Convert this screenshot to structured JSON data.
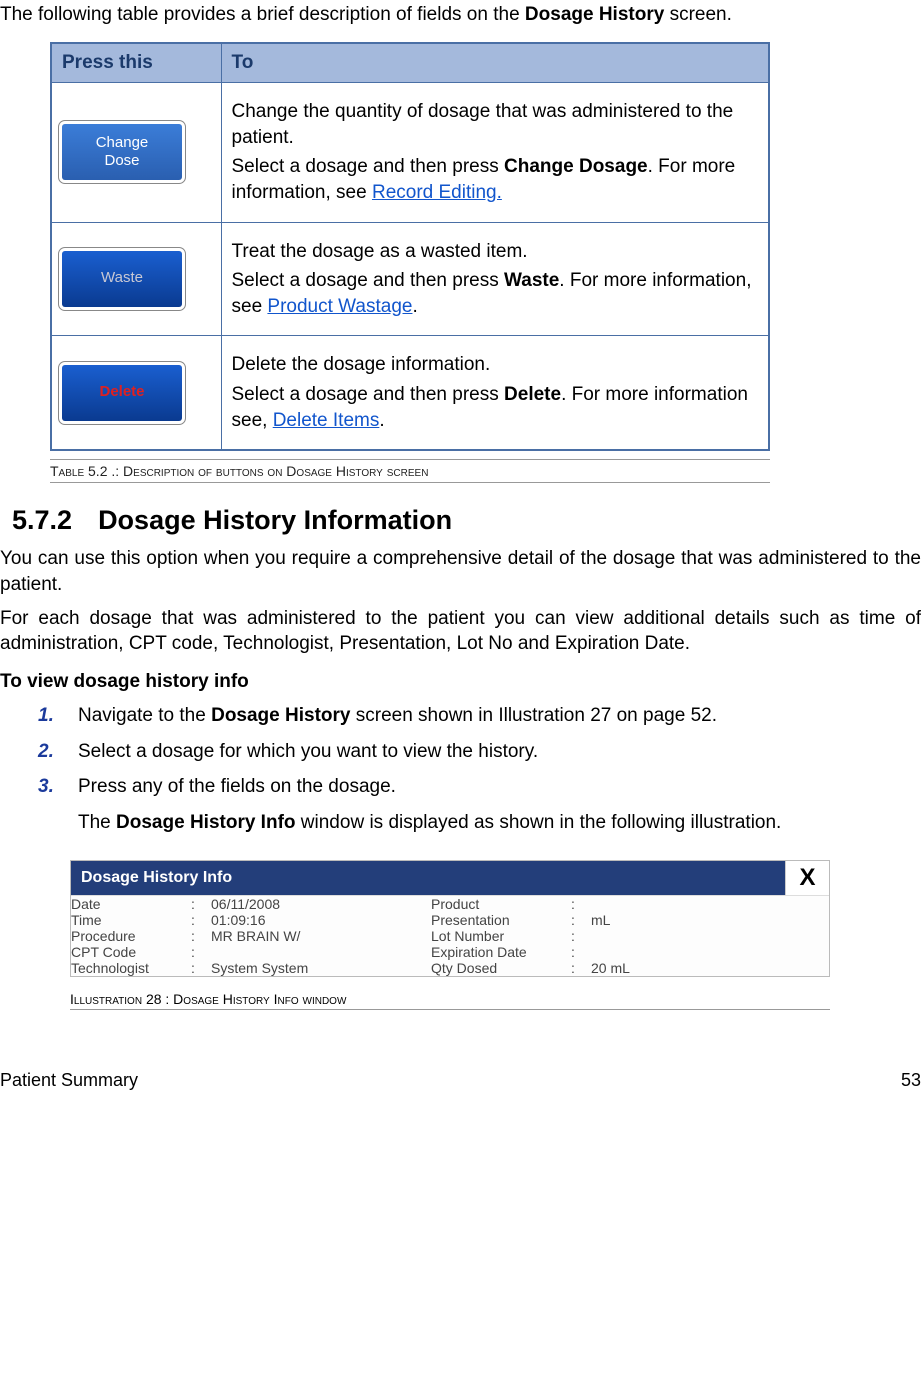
{
  "intro": {
    "pre": "The following table provides a brief description of fields on the ",
    "bold": "Dosage History",
    "post": " screen."
  },
  "table": {
    "headers": {
      "col1": "Press this",
      "col2": "To"
    },
    "rows": [
      {
        "button_label": "Change\nDose",
        "button_class": "btn-change",
        "desc1": "Change the quantity of dosage that was administered to the patient.",
        "desc2_pre": "Select a dosage and then press ",
        "desc2_bold": "Change Dosage",
        "desc2_mid": ". For more information, see ",
        "desc2_link": "Record Editing."
      },
      {
        "button_label": "Waste",
        "button_class": "btn-waste",
        "desc1": "Treat the dosage as a wasted item.",
        "desc2_pre": "Select a dosage and then press ",
        "desc2_bold": "Waste",
        "desc2_mid": ". For more information, see  ",
        "desc2_link": "Product Wastage",
        "desc2_post": "."
      },
      {
        "button_label": "Delete",
        "button_class": "btn-delete",
        "desc1": "Delete the dosage information.",
        "desc2_pre": "Select a dosage and then press ",
        "desc2_bold": "Delete",
        "desc2_mid": ".  For more information see, ",
        "desc2_link": " Delete Items",
        "desc2_post": "."
      }
    ]
  },
  "table_caption": "Table 5.2 .: Description of buttons on Dosage  History screen",
  "section": {
    "number": "5.7.2",
    "title": "Dosage History Information"
  },
  "para1": "You can use this option when you require a comprehensive detail of the dosage that was administered to the patient.",
  "para2": "For each dosage that was administered to the patient you can view additional details such as time of administration, CPT code, Technologist, Presentation, Lot No and Expiration Date.",
  "subhead": "To view dosage history info",
  "steps": [
    {
      "num": "1.",
      "pre": "Navigate to the ",
      "bold": "Dosage History",
      "post": " screen shown in Illustration 27 on page 52."
    },
    {
      "num": "2.",
      "pre": "Select a dosage for which you want to view the history.",
      "bold": "",
      "post": ""
    },
    {
      "num": "3.",
      "pre": "Press any of the fields on the dosage.",
      "bold": "",
      "post": "",
      "extra_pre": "The ",
      "extra_bold": "Dosage History Info",
      "extra_post": " window is displayed as shown in the following illustration."
    }
  ],
  "illus": {
    "title": "Dosage History Info",
    "close": "X",
    "rows": [
      {
        "l1": "Date",
        "v1": "06/11/2008",
        "l2": "Product",
        "v2": ""
      },
      {
        "l1": "Time",
        "v1": "01:09:16",
        "l2": "Presentation",
        "v2": "mL"
      },
      {
        "l1": "Procedure",
        "v1": "MR BRAIN W/",
        "l2": "Lot Number",
        "v2": ""
      },
      {
        "l1": "CPT Code",
        "v1": "",
        "l2": "Expiration Date",
        "v2": ""
      },
      {
        "l1": "Technologist",
        "v1": "System System",
        "l2": "Qty Dosed",
        "v2": "20 mL"
      }
    ]
  },
  "illus_caption": "Illustration 28 : Dosage History Info window",
  "footer": {
    "left": "Patient Summary",
    "right": "53"
  }
}
